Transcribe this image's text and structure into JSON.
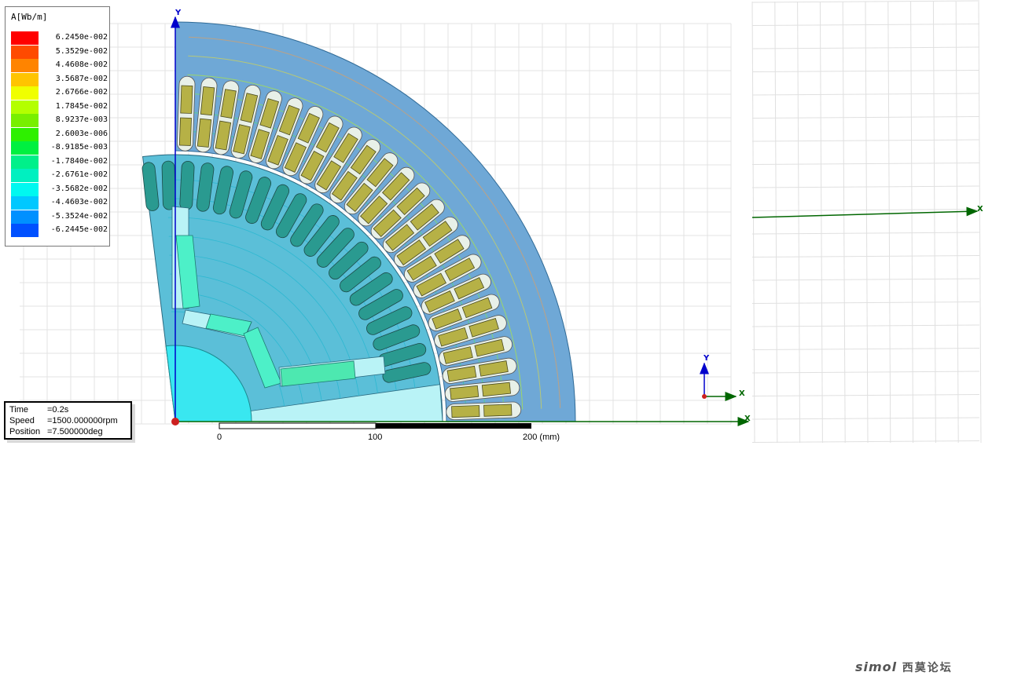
{
  "legend": {
    "title": "A[Wb/m]",
    "entries": [
      {
        "color": "#ff0000",
        "value": "6.2450e-002"
      },
      {
        "color": "#ff4a00",
        "value": "5.3529e-002"
      },
      {
        "color": "#ff8400",
        "value": "4.4608e-002"
      },
      {
        "color": "#ffc400",
        "value": "3.5687e-002"
      },
      {
        "color": "#f0ff00",
        "value": "2.6766e-002"
      },
      {
        "color": "#b4ff00",
        "value": "1.7845e-002"
      },
      {
        "color": "#78ef00",
        "value": "8.9237e-003"
      },
      {
        "color": "#2ef000",
        "value": "2.6003e-006"
      },
      {
        "color": "#00f040",
        "value": "-8.9185e-003"
      },
      {
        "color": "#00f08a",
        "value": "-1.7840e-002"
      },
      {
        "color": "#00f0c0",
        "value": "-2.6761e-002"
      },
      {
        "color": "#00f8f0",
        "value": "-3.5682e-002"
      },
      {
        "color": "#00c8ff",
        "value": "-4.4603e-002"
      },
      {
        "color": "#0090ff",
        "value": "-5.3524e-002"
      },
      {
        "color": "#0050ff",
        "value": "-6.2445e-002"
      }
    ]
  },
  "info": {
    "time": {
      "key": "Time",
      "value": "=0.2s"
    },
    "speed": {
      "key": "Speed",
      "value": "=1500.000000rpm"
    },
    "position": {
      "key": "Position",
      "value": "=7.500000deg"
    }
  },
  "scale_bar": {
    "label_0": "0",
    "label_100": "100",
    "label_200": "200 (mm)"
  },
  "axes": {
    "main_y": "Y",
    "main_x": "X",
    "triad_y": "Y",
    "triad_x": "X",
    "right_x": "X"
  },
  "colors": {
    "stator": "#6fa8d6",
    "rotor": "#5bbfd8",
    "coil": "#b6b146",
    "x_axis": "#006600",
    "y_axis": "#0000cc",
    "magnet": "#4df0c8"
  },
  "watermark": {
    "brand": "simol",
    "chinese": "西莫论坛"
  }
}
